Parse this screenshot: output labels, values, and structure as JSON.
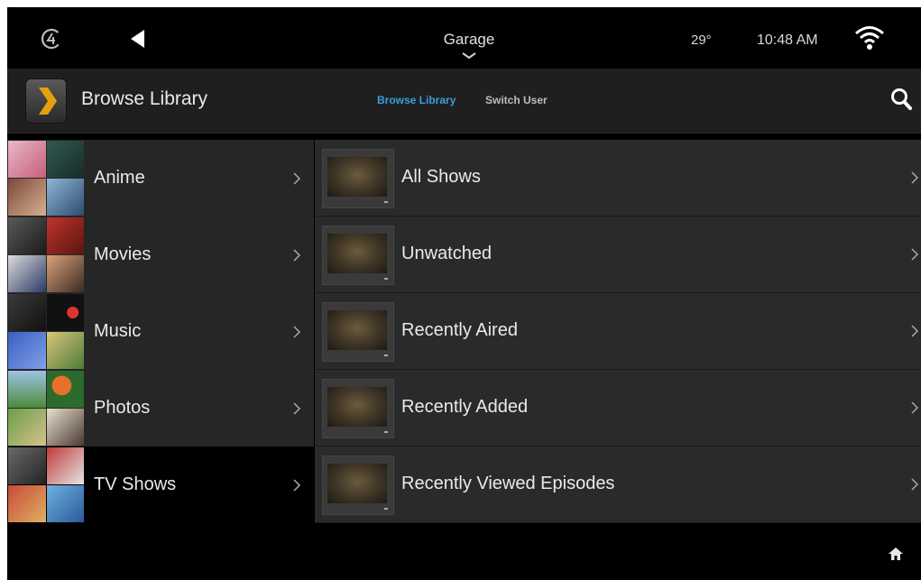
{
  "status_bar": {
    "room": "Garage",
    "temperature": "29°",
    "time": "10:48 AM"
  },
  "header": {
    "title": "Browse Library",
    "tabs": [
      {
        "label": "Browse Library",
        "active": true
      },
      {
        "label": "Switch User",
        "active": false
      }
    ]
  },
  "libraries": [
    {
      "label": "Anime",
      "selected": false
    },
    {
      "label": "Movies",
      "selected": false
    },
    {
      "label": "Music",
      "selected": false
    },
    {
      "label": "Photos",
      "selected": false
    },
    {
      "label": "TV Shows",
      "selected": true
    }
  ],
  "items": [
    {
      "label": "All Shows"
    },
    {
      "label": "Unwatched"
    },
    {
      "label": "Recently Aired"
    },
    {
      "label": "Recently Added"
    },
    {
      "label": "Recently Viewed Episodes"
    }
  ],
  "colors": {
    "accent": "#3a9edc",
    "plex_orange": "#e5a00d"
  },
  "icons": [
    "control4-logo-icon",
    "back-arrow-icon",
    "chevron-down-icon",
    "wifi-icon",
    "plex-app-icon",
    "search-icon",
    "chevron-right-icon",
    "home-icon"
  ]
}
